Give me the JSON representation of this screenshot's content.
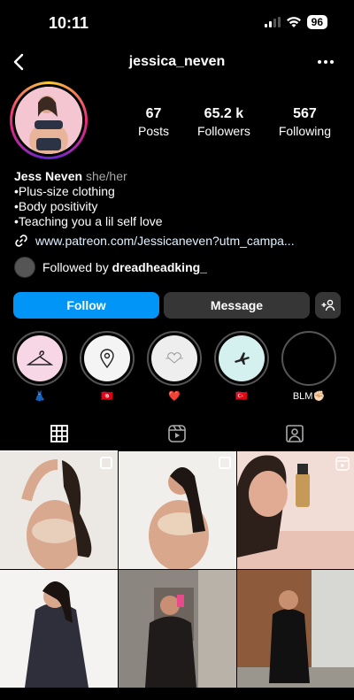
{
  "status_bar": {
    "time": "10:11",
    "battery": "96"
  },
  "header": {
    "username": "jessica_neven"
  },
  "stats": [
    {
      "value": "67",
      "label": "Posts"
    },
    {
      "value": "65.2 k",
      "label": "Followers"
    },
    {
      "value": "567",
      "label": "Following"
    }
  ],
  "bio": {
    "name": "Jess Neven",
    "pronouns": "she/her",
    "lines": [
      "•Plus-size clothing",
      "•Body positivity",
      "•Teaching you a lil self love"
    ],
    "link": "www.patreon.com/Jessicaneven?utm_campa...",
    "followed_prefix": "Followed by ",
    "followed_user": "dreadheadking_"
  },
  "buttons": {
    "follow": "Follow",
    "message": "Message"
  },
  "highlights": [
    {
      "label": "👗",
      "icon": "hanger-icon",
      "bg": "#f7d6e6"
    },
    {
      "label": "🇹🇳",
      "icon": "location-pin-icon",
      "bg": "#f4f4f4"
    },
    {
      "label": "❤️",
      "icon": "heart-doodle-icon",
      "bg": "#eeeeee"
    },
    {
      "label": "🇹🇷",
      "icon": "airplane-icon",
      "bg": "#d4f1ef"
    },
    {
      "label": "BLM✊🏻",
      "icon": "",
      "bg": "#000000"
    }
  ],
  "colors": {
    "follow_blue": "#0095f6",
    "button_gray": "#363636",
    "background": "#000000"
  }
}
